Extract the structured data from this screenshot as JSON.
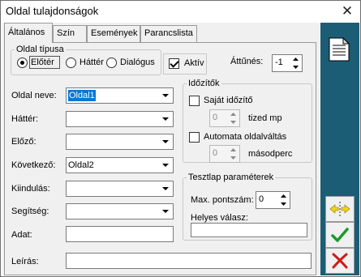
{
  "window": {
    "title": "Oldal tulajdonságok"
  },
  "tabs": [
    {
      "label": "Általános",
      "active": true
    },
    {
      "label": "Szín"
    },
    {
      "label": "Események"
    },
    {
      "label": "Parancslista"
    }
  ],
  "page_type": {
    "legend": "Oldal típusa",
    "options": [
      {
        "label": "Előtér",
        "selected": true
      },
      {
        "label": "Háttér",
        "selected": false
      },
      {
        "label": "Dialógus",
        "selected": false
      }
    ],
    "active_label": "Aktív",
    "active_checked": true
  },
  "transparency": {
    "label": "Áttűnés:",
    "value": "-1"
  },
  "fields": {
    "page_name": {
      "label": "Oldal neve:",
      "value": "Oldal1"
    },
    "background": {
      "label": "Háttér:",
      "value": ""
    },
    "previous": {
      "label": "Előző:",
      "value": ""
    },
    "next": {
      "label": "Következő:",
      "value": "Oldal2"
    },
    "start": {
      "label": "Kiindulás:",
      "value": ""
    },
    "help": {
      "label": "Segítség:",
      "value": ""
    },
    "data": {
      "label": "Adat:",
      "value": ""
    },
    "description": {
      "label": "Leírás:",
      "value": ""
    }
  },
  "timers": {
    "legend": "Időzítők",
    "own_timer_label": "Saját időzítő",
    "own_timer_value": "0",
    "own_timer_unit": "tized mp",
    "auto_switch_label": "Automata oldalváltás",
    "auto_switch_value": "0",
    "auto_switch_unit": "másodperc"
  },
  "test_params": {
    "legend": "Tesztlap paraméterek",
    "max_points_label": "Max. pontszám:",
    "max_points_value": "0",
    "correct_answer_label": "Helyes válasz:",
    "correct_answer_value": ""
  },
  "toolbar": {
    "doc_icon": "document-icon",
    "split_icon": "split-arrows-icon",
    "ok_icon": "checkmark-icon",
    "cancel_icon": "red-x-icon"
  },
  "colors": {
    "toolbar_bg": "#1b5d75",
    "selection": "#0078d7",
    "ok_green": "#1a9a2a",
    "cancel_red": "#d01818"
  }
}
